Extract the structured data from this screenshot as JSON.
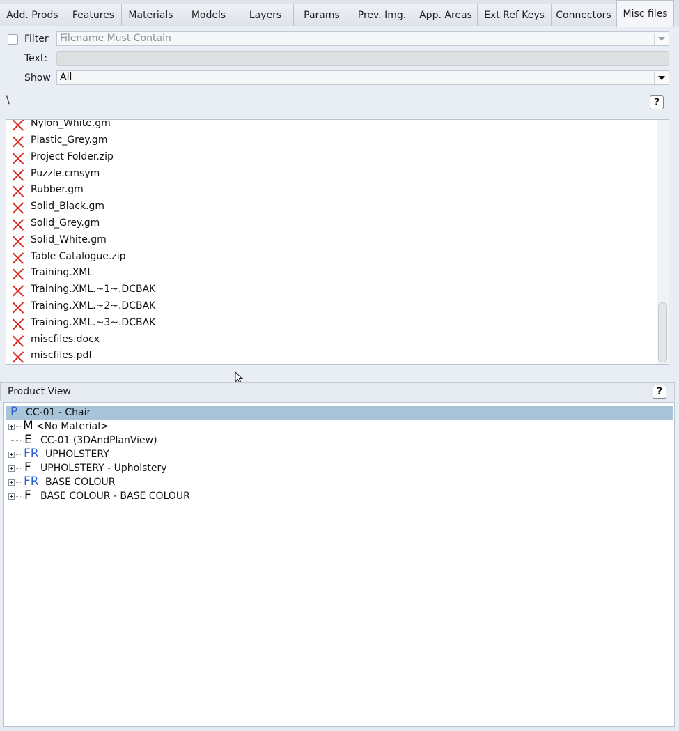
{
  "tabs": [
    {
      "label": "Add. Prods",
      "active": false
    },
    {
      "label": "Features",
      "active": false
    },
    {
      "label": "Materials",
      "active": false
    },
    {
      "label": "Models",
      "active": false
    },
    {
      "label": "Layers",
      "active": false
    },
    {
      "label": "Params",
      "active": false
    },
    {
      "label": "Prev. Img.",
      "active": false
    },
    {
      "label": "App. Areas",
      "active": false
    },
    {
      "label": "Ext Ref Keys",
      "active": false
    },
    {
      "label": "Connectors",
      "active": false
    },
    {
      "label": "Misc files",
      "active": true
    }
  ],
  "filter": {
    "checkbox_label": "Filter",
    "placeholder": "Filename Must Contain",
    "text_label": "Text:",
    "text_value": "",
    "show_label": "Show",
    "show_value": "All"
  },
  "path": "\\",
  "help_label": "?",
  "files": [
    "Nylon_White.gm",
    "Plastic_Grey.gm",
    "Project Folder.zip",
    "Puzzle.cmsym",
    "Rubber.gm",
    "Solid_Black.gm",
    "Solid_Grey.gm",
    "Solid_White.gm",
    "Table Catalogue.zip",
    "Training.XML",
    "Training.XML.~1~.DCBAK",
    "Training.XML.~2~.DCBAK",
    "Training.XML.~3~.DCBAK",
    "miscfiles.docx",
    "miscfiles.pdf"
  ],
  "product_view": {
    "title": "Product View",
    "tree": [
      {
        "letter": "P",
        "text": "CC-01 - Chair",
        "expandable": false,
        "selected": true,
        "blue": true
      },
      {
        "letter": "M",
        "text": "<No Material>",
        "expandable": true,
        "selected": false,
        "blue": false
      },
      {
        "letter": "E",
        "text": "CC-01 (3DAndPlanView)",
        "expandable": false,
        "selected": false,
        "blue": false
      },
      {
        "letter": "FR",
        "text": "UPHOLSTERY",
        "expandable": true,
        "selected": false,
        "blue": true
      },
      {
        "letter": "F",
        "text": "UPHOLSTERY - Upholstery",
        "expandable": true,
        "selected": false,
        "blue": false
      },
      {
        "letter": "FR",
        "text": "BASE COLOUR",
        "expandable": true,
        "selected": false,
        "blue": true
      },
      {
        "letter": "F",
        "text": "BASE COLOUR - BASE COLOUR",
        "expandable": true,
        "selected": false,
        "blue": false
      }
    ]
  },
  "colors": {
    "accent_selection": "#a8c4d9",
    "delete_icon": "#d8271c",
    "node_letter_blue": "#2e5fd0"
  },
  "icons": {
    "file_icon": "red-x-icon",
    "help": "help-icon",
    "dropdown": "chevron-down-icon",
    "expander": "plus-box-icon"
  }
}
